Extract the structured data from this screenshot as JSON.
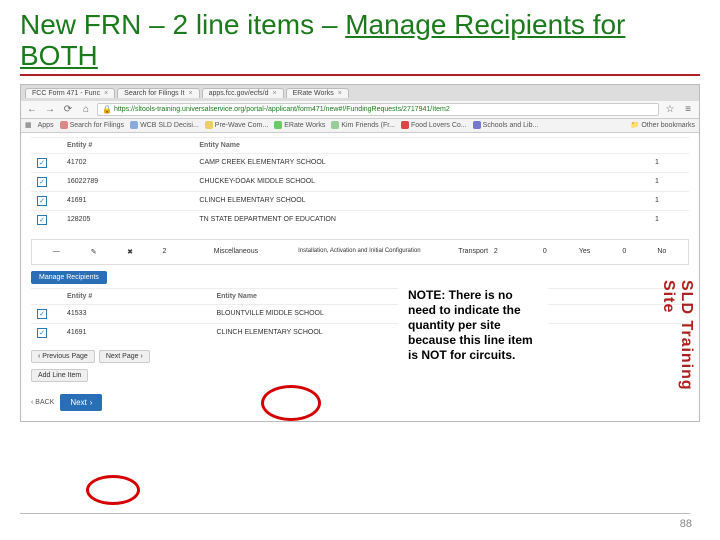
{
  "slide": {
    "title_prefix": "New FRN – 2 line items – ",
    "title_underlined": "Manage Recipients for BOTH",
    "page_number": "88"
  },
  "browser": {
    "tabs": [
      {
        "label": "FCC Form 471 - Func"
      },
      {
        "label": "Search for Filings It"
      },
      {
        "label": "apps.fcc.gov/ecfs/d"
      },
      {
        "label": "ERate Works"
      }
    ],
    "url": "https://sltools-training.universalservice.org/portal-/applicant/form471/new#!/FundingRequests/2717941/Item2",
    "bookmarks": [
      {
        "label": "Apps"
      },
      {
        "label": "Search for Filings"
      },
      {
        "label": "WCB SLD Decisi..."
      },
      {
        "label": "Pre-Wave Com..."
      },
      {
        "label": "ERate Works"
      },
      {
        "label": "Kim Friends (Fr..."
      },
      {
        "label": "Food Lovers Co..."
      },
      {
        "label": "Schools and Lib..."
      }
    ],
    "other_bookmarks": "Other bookmarks"
  },
  "recipients1": {
    "headers": [
      "",
      "Entity #",
      "Entity Name",
      ""
    ],
    "rows": [
      {
        "checked": true,
        "id": "41702",
        "name": "CAMP CREEK ELEMENTARY SCHOOL",
        "qty": "1"
      },
      {
        "checked": true,
        "id": "16022789",
        "name": "CHUCKEY-DOAK MIDDLE SCHOOL",
        "qty": "1"
      },
      {
        "checked": true,
        "id": "41691",
        "name": "CLINCH ELEMENTARY SCHOOL",
        "qty": "1"
      },
      {
        "checked": true,
        "id": "128205",
        "name": "TN STATE DEPARTMENT OF EDUCATION",
        "qty": "1"
      }
    ]
  },
  "line_item_row": {
    "num": "2",
    "type": "Miscellaneous",
    "detail": "Installation, Activation and Initial Configuration",
    "transport_label": "Transport",
    "transport_val": "2",
    "zero": "0",
    "yes": "Yes",
    "zero2": "0",
    "no": "No"
  },
  "manage_button": "Manage Recipients",
  "recipients2": {
    "headers": [
      "",
      "Entity #",
      "Entity Name"
    ],
    "rows": [
      {
        "checked": true,
        "id": "41533",
        "name": "BLOUNTVILLE MIDDLE SCHOOL"
      },
      {
        "checked": true,
        "id": "41691",
        "name": "CLINCH ELEMENTARY SCHOOL"
      }
    ]
  },
  "buttons": {
    "prev_page": "‹ Previous Page",
    "next_page": "Next Page ›",
    "add_line": "Add Line Item",
    "back": "‹ BACK",
    "next": "Next"
  },
  "note": "NOTE: There is no need to indicate the quantity per site because this line item is NOT for circuits.",
  "side_label": "SLD Training Site"
}
